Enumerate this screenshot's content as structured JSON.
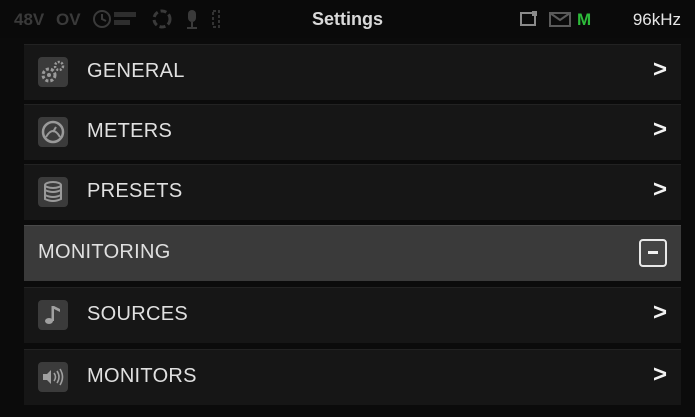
{
  "status_bar": {
    "phantom_power": "48V",
    "overload": "OV",
    "title": "Settings",
    "sample_rate": "96kHz",
    "meter_mode": "M",
    "accent_green": "#2dbb3a",
    "icons": [
      "timecode-icon",
      "sync-icon",
      "mic-icon",
      "battery-icon",
      "card-icon",
      "mail-icon"
    ]
  },
  "menu": {
    "items": [
      {
        "label": "GENERAL",
        "icon": "gears-icon",
        "chevron": ">"
      },
      {
        "label": "METERS",
        "icon": "meter-gauge-icon",
        "chevron": ">"
      },
      {
        "label": "PRESETS",
        "icon": "database-icon",
        "chevron": ">"
      },
      {
        "label": "MONITORING",
        "icon": "",
        "chevron": ""
      },
      {
        "label": "SOURCES",
        "icon": "music-note-icon",
        "chevron": ">"
      },
      {
        "label": "MONITORS",
        "icon": "speaker-icon",
        "chevron": ">"
      }
    ]
  }
}
